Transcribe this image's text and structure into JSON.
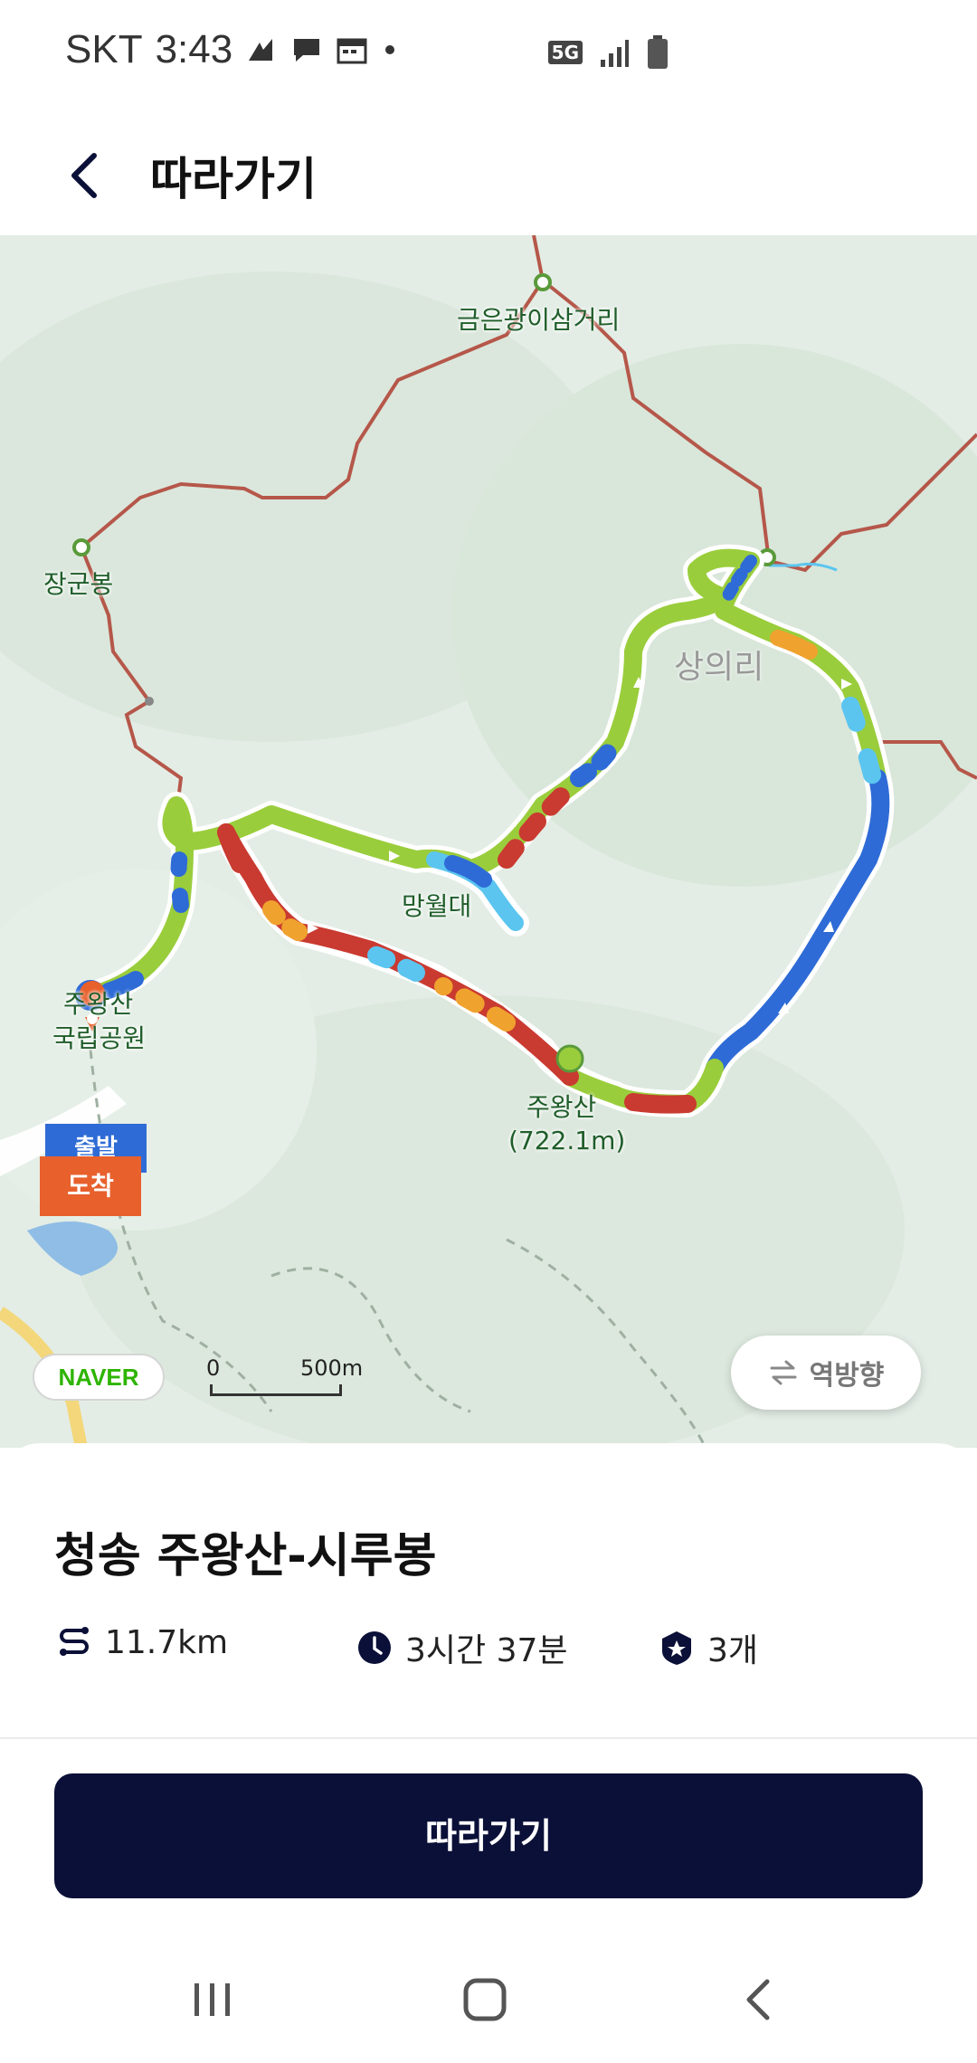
{
  "status_bar": {
    "carrier": "SKT",
    "time": "3:43",
    "network": "5G"
  },
  "app_bar": {
    "title": "따라가기",
    "back_icon": "chevron-left-icon"
  },
  "map": {
    "labels": {
      "junction": "금은광이삼거리",
      "peak_janggun": "장군봉",
      "sanguiri": "상의리",
      "mangwoldae": "망월대",
      "juwangsan": "주왕산",
      "juwangsan_height": "(722.1m)",
      "park_line1": "주왕산",
      "park_line2": "국립공원"
    },
    "badge_start": "출발",
    "badge_end": "도착",
    "provider": "NAVER",
    "scale_zero": "0",
    "scale_distance": "500m",
    "reverse_button": "역방향",
    "colors": {
      "trail": "#b5574a",
      "route_green": "#9acd3c",
      "route_red": "#c93a30",
      "route_blue": "#2e6bd6",
      "route_orange": "#f0a22e",
      "route_cyan": "#5bc5f0"
    }
  },
  "course": {
    "title": "청송 주왕산-시루봉",
    "distance": "11.7km",
    "duration": "3시간 37분",
    "badges": "3개"
  },
  "actions": {
    "follow_button": "따라가기"
  },
  "nav_bar": {
    "recent_icon": "recent-apps-icon",
    "home_icon": "home-icon",
    "back_icon": "back-icon"
  }
}
